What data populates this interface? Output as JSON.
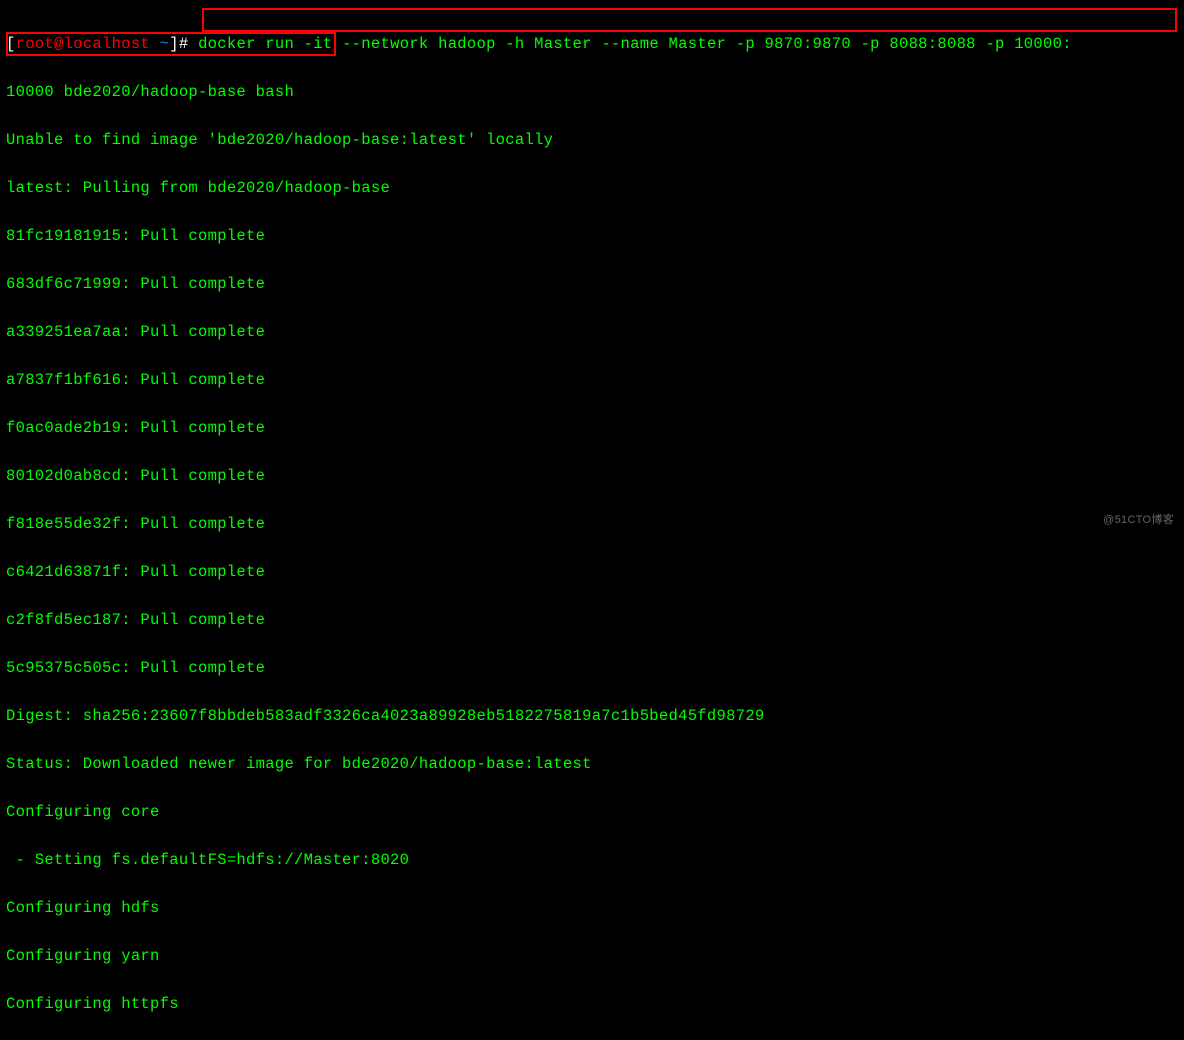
{
  "prompt": {
    "open_bracket": "[",
    "user_host": "root@localhost ",
    "path": "~",
    "close_bracket": "]# "
  },
  "command": {
    "line1": "docker run -it --network hadoop -h Master --name Master -p 9870:9870 -p 8088:8088 -p 10000:",
    "line2": "10000 bde2020/hadoop-base bash"
  },
  "output": {
    "unable": "Unable to find image 'bde2020/hadoop-base:latest' locally",
    "pulling": "latest: Pulling from bde2020/hadoop-base",
    "layers": [
      "81fc19181915: Pull complete",
      "683df6c71999: Pull complete",
      "a339251ea7aa: Pull complete",
      "a7837f1bf616: Pull complete",
      "f0ac0ade2b19: Pull complete",
      "80102d0ab8cd: Pull complete",
      "f818e55de32f: Pull complete",
      "c6421d63871f: Pull complete",
      "c2f8fd5ec187: Pull complete",
      "5c95375c505c: Pull complete"
    ],
    "digest": "Digest: sha256:23607f8bbdeb583adf3326ca4023a89928eb5182275819a7c1b5bed45fd98729",
    "status": "Status: Downloaded newer image for bde2020/hadoop-base:latest",
    "config_core": "Configuring core",
    "setting": " - Setting fs.defaultFS=hdfs://Master:8020",
    "config_hdfs": "Configuring hdfs",
    "config_yarn": "Configuring yarn",
    "config_httpfs": "Configuring httpfs"
  },
  "watermark": "@51CTO博客"
}
